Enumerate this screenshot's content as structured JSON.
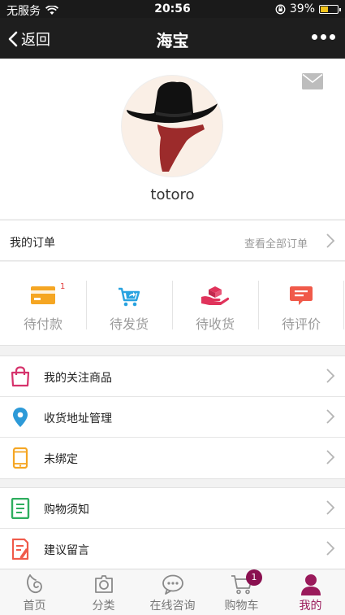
{
  "status_bar": {
    "carrier": "无服务",
    "time": "20:56",
    "battery": "39%",
    "battery_level": 0.39
  },
  "nav": {
    "back_label": "返回",
    "title": "海宝"
  },
  "profile": {
    "username": "totoro"
  },
  "orders": {
    "title": "我的订单",
    "view_all": "查看全部订单",
    "statuses": [
      {
        "label": "待付款",
        "badge": "1",
        "icon": "credit-card-icon",
        "color": "#f5a623"
      },
      {
        "label": "待发货",
        "icon": "cart-share-icon",
        "color": "#29a3e0"
      },
      {
        "label": "待收货",
        "icon": "hand-package-icon",
        "color": "#e0335b"
      },
      {
        "label": "待评价",
        "icon": "comment-icon",
        "color": "#f05a4a"
      }
    ]
  },
  "menu_group_1": [
    {
      "label": "我的关注商品",
      "icon": "shopping-bag-icon",
      "color": "#d6336c"
    },
    {
      "label": "收货地址管理",
      "icon": "location-pin-icon",
      "color": "#2d9ad8"
    },
    {
      "label": "未绑定",
      "icon": "phone-icon",
      "color": "#f5a623"
    }
  ],
  "menu_group_2": [
    {
      "label": "购物须知",
      "icon": "notes-icon",
      "color": "#2fae5f"
    },
    {
      "label": "建议留言",
      "icon": "feedback-icon",
      "color": "#f05a4a"
    }
  ],
  "tabbar": {
    "items": [
      {
        "label": "首页",
        "icon": "home-icon"
      },
      {
        "label": "分类",
        "icon": "category-icon"
      },
      {
        "label": "在线咨询",
        "icon": "chat-icon"
      },
      {
        "label": "购物车",
        "icon": "cart-icon",
        "badge": "1"
      },
      {
        "label": "我的",
        "icon": "user-icon",
        "active": true
      }
    ],
    "active_color": "#9a1a5b"
  }
}
